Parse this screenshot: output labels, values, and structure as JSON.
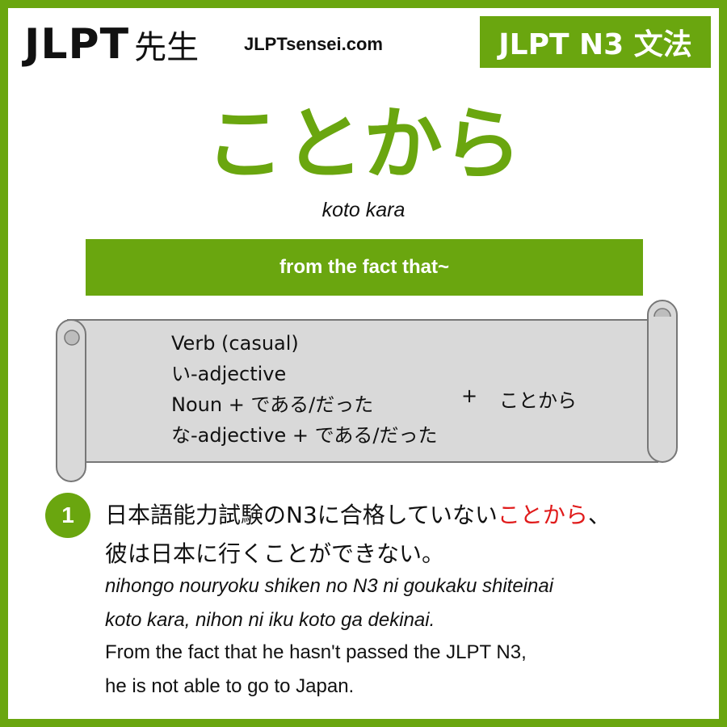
{
  "header": {
    "logo_text": "JLPT",
    "logo_kanji": "先生",
    "site_url": "JLPTsensei.com",
    "level_badge": "JLPT N3 文法"
  },
  "grammar": {
    "title": "ことから",
    "romaji": "koto kara",
    "meaning": "from the fact that~"
  },
  "formation": {
    "items": [
      "Verb (casual)",
      "い-adjective",
      "Noun + である/だった",
      "な-adjective + である/だった"
    ],
    "plus": "+",
    "target": "ことから"
  },
  "example": {
    "number": "1",
    "jp_line1_before": "日本語能力試験のN3に合格していない",
    "jp_line1_highlight": "ことから",
    "jp_line1_after": "、",
    "jp_line2": "彼は日本に行くことができない。",
    "romaji_line1": "nihongo nouryoku shiken no N3 ni goukaku shiteinai",
    "romaji_line2": "koto kara, nihon ni iku koto ga dekinai.",
    "en_line1": "From the fact that he hasn't passed the JLPT N3,",
    "en_line2": "he is not able to go to Japan."
  },
  "colors": {
    "accent": "#6aa60f",
    "highlight": "#e01b1b",
    "scroll_fill": "#d9d9d9"
  }
}
